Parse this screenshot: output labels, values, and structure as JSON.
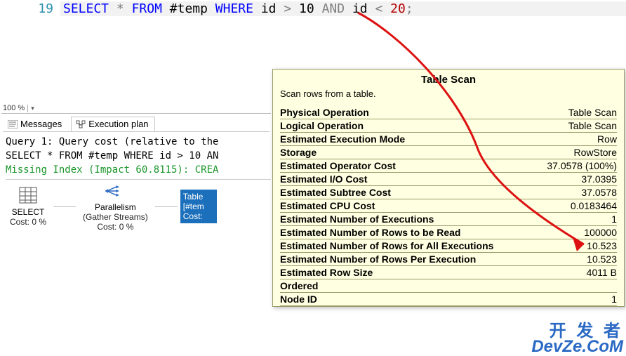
{
  "editor": {
    "line_number": "19",
    "tokens": {
      "select": "SELECT",
      "star": "*",
      "from": "FROM",
      "table": "#temp",
      "where": "WHERE",
      "col1": "id",
      "gt": ">",
      "v1": "10",
      "and": "AND",
      "col2": "id",
      "lt": "<",
      "v2": "20",
      "semi": ";"
    }
  },
  "zoom": {
    "value": "100 %"
  },
  "tabs": {
    "messages": "Messages",
    "exec_plan": "Execution plan"
  },
  "query_header": {
    "line1": "Query 1: Query cost (relative to the",
    "line2": "SELECT * FROM #temp WHERE id > 10 AN",
    "missing": "Missing Index (Impact 60.8115): CREA"
  },
  "plan": {
    "select": {
      "label": "SELECT",
      "cost": "Cost: 0 %"
    },
    "parallelism": {
      "label": "Parallelism",
      "sub": "(Gather Streams)",
      "cost": "Cost: 0 %"
    },
    "tablescan": {
      "l1": "Table",
      "l2": "[#tem",
      "l3": "Cost:"
    }
  },
  "tooltip": {
    "title": "Table Scan",
    "description": "Scan rows from a table.",
    "props": [
      {
        "label": "Physical Operation",
        "value": "Table Scan"
      },
      {
        "label": "Logical Operation",
        "value": "Table Scan"
      },
      {
        "label": "Estimated Execution Mode",
        "value": "Row"
      },
      {
        "label": "Storage",
        "value": "RowStore"
      },
      {
        "label": "Estimated Operator Cost",
        "value": "37.0578 (100%)"
      },
      {
        "label": "Estimated I/O Cost",
        "value": "37.0395"
      },
      {
        "label": "Estimated Subtree Cost",
        "value": "37.0578"
      },
      {
        "label": "Estimated CPU Cost",
        "value": "0.0183464"
      },
      {
        "label": "Estimated Number of Executions",
        "value": "1"
      },
      {
        "label": "Estimated Number of Rows to be Read",
        "value": "100000"
      },
      {
        "label": "Estimated Number of Rows for All Executions",
        "value": "10.523"
      },
      {
        "label": "Estimated Number of Rows Per Execution",
        "value": "10.523"
      },
      {
        "label": "Estimated Row Size",
        "value": "4011 B"
      },
      {
        "label": "Ordered",
        "value": ""
      },
      {
        "label": "Node ID",
        "value": "1"
      }
    ]
  },
  "watermark": {
    "l1": "开 发 者",
    "l2": "DevZe.CoM"
  }
}
